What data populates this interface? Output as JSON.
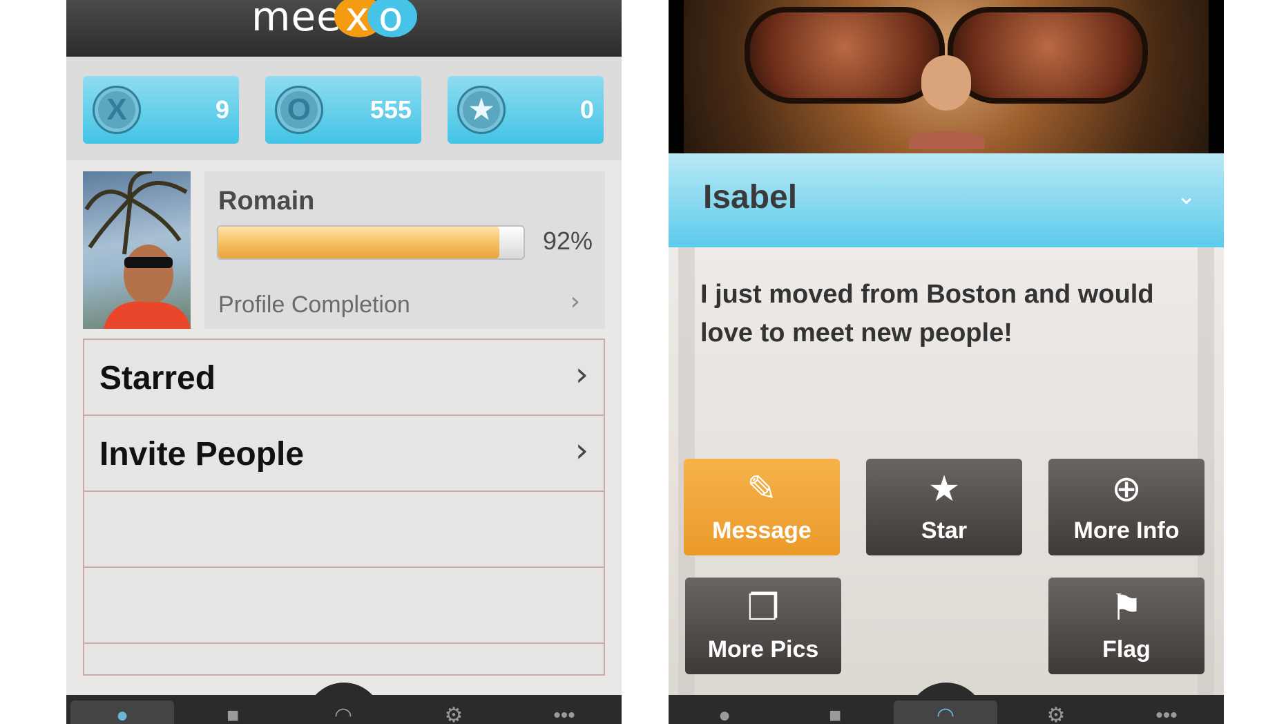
{
  "left": {
    "logo": {
      "prefix": "mee",
      "x": "x",
      "o": "o"
    },
    "stats": [
      {
        "icon": "x-icon",
        "glyph": "X",
        "value": "9"
      },
      {
        "icon": "o-icon",
        "glyph": "O",
        "value": "555"
      },
      {
        "icon": "star-icon",
        "glyph": "★",
        "value": "0"
      }
    ],
    "profile": {
      "name": "Romain",
      "progress_percent": 92,
      "progress_label": "92%",
      "completion_label": "Profile Completion"
    },
    "menu": [
      {
        "label": "Starred"
      },
      {
        "label": "Invite People"
      }
    ],
    "tabs": [
      {
        "icon": "person-icon",
        "active": true
      },
      {
        "icon": "chat-icon",
        "active": false
      },
      {
        "icon": "location-icon",
        "active": false
      },
      {
        "icon": "gear-icon",
        "active": false
      },
      {
        "icon": "more-icon",
        "active": false
      }
    ]
  },
  "right": {
    "name": "Isabel",
    "bio": "I just moved from Boston and would love to meet new people!",
    "actions": {
      "message": "Message",
      "star": "Star",
      "more_info": "More Info",
      "more_pics": "More Pics",
      "flag": "Flag"
    },
    "tabs": [
      {
        "icon": "person-icon",
        "active": false
      },
      {
        "icon": "chat-icon",
        "active": false
      },
      {
        "icon": "location-icon",
        "active": true
      },
      {
        "icon": "gear-icon",
        "active": false
      },
      {
        "icon": "more-icon",
        "active": false
      }
    ]
  },
  "colors": {
    "accent_blue": "#42c4e6",
    "accent_orange": "#eb9a2a",
    "progress_fill": "#f7c063"
  }
}
